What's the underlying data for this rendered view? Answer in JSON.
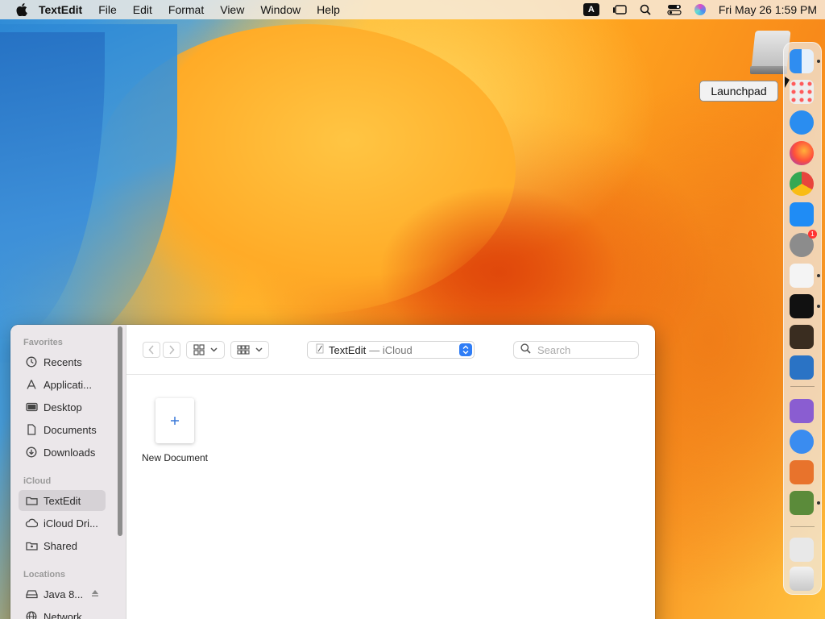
{
  "menubar": {
    "app": "TextEdit",
    "items": [
      "File",
      "Edit",
      "Format",
      "View",
      "Window",
      "Help"
    ],
    "input_source": "A",
    "datetime": "Fri May 26  1:59 PM"
  },
  "tooltip": "Launchpad",
  "dock": {
    "items": [
      {
        "name": "finder",
        "color": "#2f8df0"
      },
      {
        "name": "launchpad",
        "color": "#eaeaea"
      },
      {
        "name": "safari",
        "color": "#2a8df0"
      },
      {
        "name": "firefox",
        "color": "#ff6a1a"
      },
      {
        "name": "chrome",
        "color": "#ffffff"
      },
      {
        "name": "app-store",
        "color": "#1f8cf5"
      },
      {
        "name": "system-settings",
        "color": "#8c8c8c"
      },
      {
        "name": "textedit",
        "color": "#f4f4f4"
      },
      {
        "name": "terminal",
        "color": "#111111"
      },
      {
        "name": "guitar-app",
        "color": "#3a2d20"
      },
      {
        "name": "vscode",
        "color": "#2a73c5"
      },
      {
        "name": "visual-studio",
        "color": "#8a5dd1"
      },
      {
        "name": "launcher-app",
        "color": "#3a8cf0"
      },
      {
        "name": "network-app",
        "color": "#e8732c"
      },
      {
        "name": "minecraft",
        "color": "#5b8b3a"
      },
      {
        "name": "preview-window",
        "color": "#e8e8e8"
      },
      {
        "name": "trash",
        "color": "#dcdcdc"
      }
    ],
    "settings_badge": "1"
  },
  "window": {
    "sidebar": {
      "favorites_header": "Favorites",
      "favorites": [
        "Recents",
        "Applicati...",
        "Desktop",
        "Documents",
        "Downloads"
      ],
      "icloud_header": "iCloud",
      "icloud": [
        "TextEdit",
        "iCloud Dri...",
        "Shared"
      ],
      "locations_header": "Locations",
      "locations": [
        "Java 8...",
        "Network"
      ]
    },
    "location": {
      "name": "TextEdit",
      "sub": "— iCloud"
    },
    "search_placeholder": "Search",
    "new_document_label": "New Document"
  }
}
